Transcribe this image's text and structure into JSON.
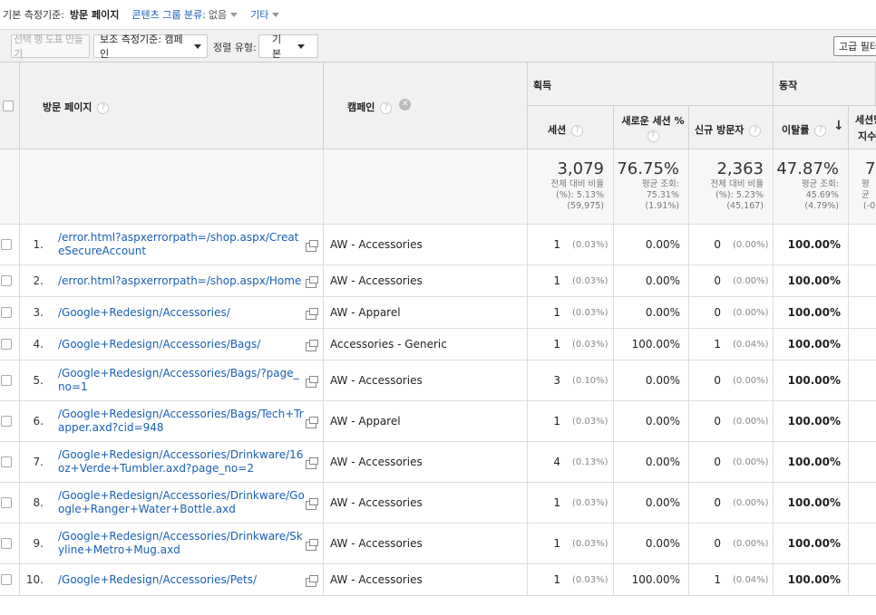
{
  "dimension_bar": {
    "primary_label": "기본 측정기준:",
    "primary_value": "방문 페이지",
    "content_group_label": "콘텐츠 그룹 분류:",
    "content_group_value": "없음",
    "other_label": "기타"
  },
  "toolbar": {
    "make_chart_label": "선택 행 도표 만들기",
    "secondary_dim_label": "보조 측정기준: 캠페인",
    "sort_type_label": "정렬 유형:",
    "sort_type_value": "기본",
    "advanced_filter_label": "고급 필터"
  },
  "table": {
    "headers": {
      "landing_page": "방문 페이지",
      "campaign": "캠페인",
      "group_acquisition": "획득",
      "group_behavior": "동작",
      "sessions": "세션",
      "new_sessions_pct": "새로운 세션 %",
      "new_users": "신규 방문자",
      "bounce_rate": "이탈률",
      "pages_per_session": "세션당",
      "pages_per_session_2": "지수"
    },
    "totals": {
      "sessions": "3,079",
      "sessions_sub1": "전체 대비 비율",
      "sessions_sub2": "(%): 5.13%",
      "sessions_sub3": "(59,975)",
      "new_sessions": "76.75%",
      "new_sessions_sub1": "평균 조회:",
      "new_sessions_sub2": "75.31%",
      "new_sessions_sub3": "(1.91%)",
      "new_users": "2,363",
      "new_users_sub1": "전체 대비 비율",
      "new_users_sub2": "(%): 5.23%",
      "new_users_sub3": "(45,167)",
      "bounce": "47.87%",
      "bounce_sub1": "평균 조회:",
      "bounce_sub2": "45.69%",
      "bounce_sub3": "(4.79%)",
      "next": "7",
      "next_sub1": "평균",
      "next_sub3": "(-0"
    },
    "rows": [
      {
        "n": "1.",
        "page": "/error.html?aspxerrorpath=/shop.aspx/CreateSecureAccount",
        "campaign": "AW - Accessories",
        "sessions": "1",
        "sessions_pct": "(0.03%)",
        "new_sessions": "0.00%",
        "new_users": "0",
        "new_users_pct": "(0.00%)",
        "bounce": "100.00%"
      },
      {
        "n": "2.",
        "page": "/error.html?aspxerrorpath=/shop.aspx/Home",
        "campaign": "AW - Accessories",
        "sessions": "1",
        "sessions_pct": "(0.03%)",
        "new_sessions": "0.00%",
        "new_users": "0",
        "new_users_pct": "(0.00%)",
        "bounce": "100.00%"
      },
      {
        "n": "3.",
        "page": "/Google+Redesign/Accessories/",
        "campaign": "AW - Apparel",
        "sessions": "1",
        "sessions_pct": "(0.03%)",
        "new_sessions": "0.00%",
        "new_users": "0",
        "new_users_pct": "(0.00%)",
        "bounce": "100.00%"
      },
      {
        "n": "4.",
        "page": "/Google+Redesign/Accessories/Bags/",
        "campaign": "Accessories - Generic",
        "sessions": "1",
        "sessions_pct": "(0.03%)",
        "new_sessions": "100.00%",
        "new_users": "1",
        "new_users_pct": "(0.04%)",
        "bounce": "100.00%"
      },
      {
        "n": "5.",
        "page": "/Google+Redesign/Accessories/Bags/?page_no=1",
        "campaign": "AW - Accessories",
        "sessions": "3",
        "sessions_pct": "(0.10%)",
        "new_sessions": "0.00%",
        "new_users": "0",
        "new_users_pct": "(0.00%)",
        "bounce": "100.00%"
      },
      {
        "n": "6.",
        "page": "/Google+Redesign/Accessories/Bags/Tech+Trapper.axd?cid=948",
        "campaign": "AW - Apparel",
        "sessions": "1",
        "sessions_pct": "(0.03%)",
        "new_sessions": "0.00%",
        "new_users": "0",
        "new_users_pct": "(0.00%)",
        "bounce": "100.00%"
      },
      {
        "n": "7.",
        "page": "/Google+Redesign/Accessories/Drinkware/16oz+Verde+Tumbler.axd?page_no=2",
        "campaign": "AW - Accessories",
        "sessions": "4",
        "sessions_pct": "(0.13%)",
        "new_sessions": "0.00%",
        "new_users": "0",
        "new_users_pct": "(0.00%)",
        "bounce": "100.00%"
      },
      {
        "n": "8.",
        "page": "/Google+Redesign/Accessories/Drinkware/Google+Ranger+Water+Bottle.axd",
        "campaign": "AW - Accessories",
        "sessions": "1",
        "sessions_pct": "(0.03%)",
        "new_sessions": "0.00%",
        "new_users": "0",
        "new_users_pct": "(0.00%)",
        "bounce": "100.00%"
      },
      {
        "n": "9.",
        "page": "/Google+Redesign/Accessories/Drinkware/Skyline+Metro+Mug.axd",
        "campaign": "AW - Accessories",
        "sessions": "1",
        "sessions_pct": "(0.03%)",
        "new_sessions": "0.00%",
        "new_users": "0",
        "new_users_pct": "(0.00%)",
        "bounce": "100.00%"
      },
      {
        "n": "10.",
        "page": "/Google+Redesign/Accessories/Pets/",
        "campaign": "AW - Accessories",
        "sessions": "1",
        "sessions_pct": "(0.03%)",
        "new_sessions": "100.00%",
        "new_users": "1",
        "new_users_pct": "(0.04%)",
        "bounce": "100.00%"
      }
    ]
  }
}
